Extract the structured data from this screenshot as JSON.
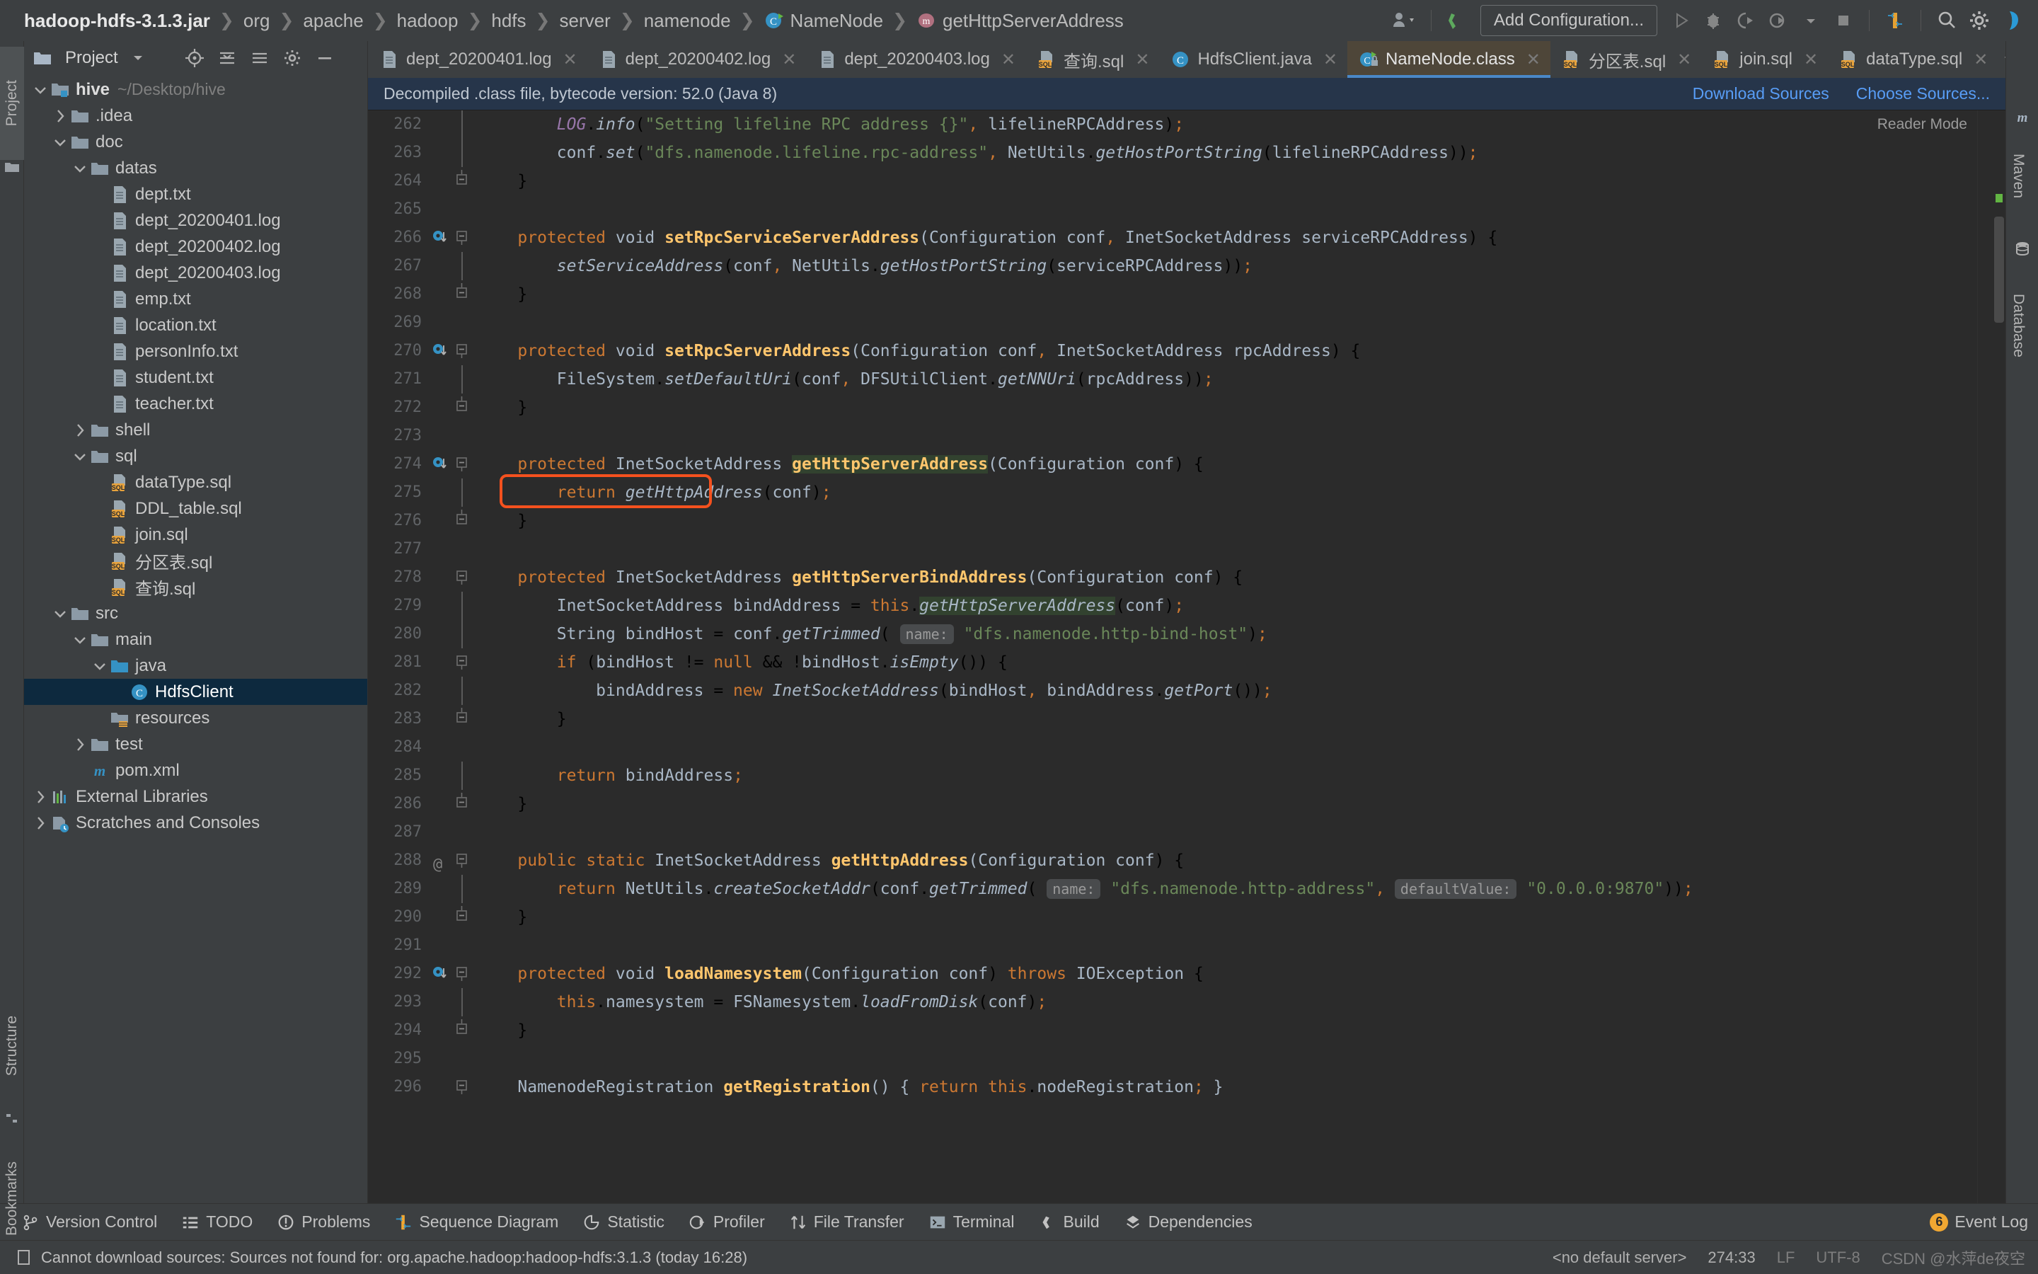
{
  "window": {
    "breadcrumb": [
      {
        "label": "hadoop-hdfs-3.1.3.jar",
        "icon": "jar-icon",
        "bold": true
      },
      {
        "label": "org",
        "icon": "none"
      },
      {
        "label": "apache",
        "icon": "none"
      },
      {
        "label": "hadoop",
        "icon": "none"
      },
      {
        "label": "hdfs",
        "icon": "none"
      },
      {
        "label": "server",
        "icon": "none"
      },
      {
        "label": "namenode",
        "icon": "none"
      },
      {
        "label": "NameNode",
        "icon": "class-icon"
      },
      {
        "label": "getHttpServerAddress",
        "icon": "method-icon"
      }
    ],
    "toolbar": {
      "add_configuration": "Add Configuration...",
      "icons": [
        "user-dropdown-icon",
        "build-icon",
        "run-icon",
        "debug-icon",
        "run-coverage-icon",
        "profile-icon",
        "stop-icon",
        "sequence-diagram-icon",
        "search-everywhere-icon",
        "settings-gear-icon",
        "ide-help-icon"
      ]
    }
  },
  "left_strip": {
    "top_tabs": [
      {
        "label": "Project",
        "icon": "project-folder-icon"
      }
    ],
    "bottom_tabs": [
      {
        "label": "Structure",
        "icon": "structure-icon"
      },
      {
        "label": "Bookmarks",
        "icon": "bookmark-icon"
      }
    ]
  },
  "right_strip": {
    "tabs": [
      {
        "label": "Maven",
        "icon": "maven-m-icon"
      },
      {
        "label": "Database",
        "icon": "database-icon"
      }
    ]
  },
  "project_panel": {
    "title": "Project",
    "header_icons": [
      "target-icon",
      "expand-icon",
      "collapse-icon",
      "settings-icon",
      "hide-icon"
    ],
    "tree": [
      {
        "label": "hive",
        "path": "~/Desktop/hive",
        "indent": 0,
        "twist": "down",
        "icon": "module-folder-icon",
        "bold": true
      },
      {
        "label": ".idea",
        "indent": 1,
        "twist": "right",
        "icon": "folder-icon"
      },
      {
        "label": "doc",
        "indent": 1,
        "twist": "down",
        "icon": "folder-icon"
      },
      {
        "label": "datas",
        "indent": 2,
        "twist": "down",
        "icon": "folder-icon"
      },
      {
        "label": "dept.txt",
        "indent": 3,
        "twist": "none",
        "icon": "text-file-icon"
      },
      {
        "label": "dept_20200401.log",
        "indent": 3,
        "twist": "none",
        "icon": "text-file-icon"
      },
      {
        "label": "dept_20200402.log",
        "indent": 3,
        "twist": "none",
        "icon": "text-file-icon"
      },
      {
        "label": "dept_20200403.log",
        "indent": 3,
        "twist": "none",
        "icon": "text-file-icon"
      },
      {
        "label": "emp.txt",
        "indent": 3,
        "twist": "none",
        "icon": "text-file-icon"
      },
      {
        "label": "location.txt",
        "indent": 3,
        "twist": "none",
        "icon": "text-file-icon"
      },
      {
        "label": "personInfo.txt",
        "indent": 3,
        "twist": "none",
        "icon": "text-file-icon"
      },
      {
        "label": "student.txt",
        "indent": 3,
        "twist": "none",
        "icon": "text-file-icon"
      },
      {
        "label": "teacher.txt",
        "indent": 3,
        "twist": "none",
        "icon": "text-file-icon"
      },
      {
        "label": "shell",
        "indent": 2,
        "twist": "right",
        "icon": "folder-icon"
      },
      {
        "label": "sql",
        "indent": 2,
        "twist": "down",
        "icon": "folder-icon"
      },
      {
        "label": "dataType.sql",
        "indent": 3,
        "twist": "none",
        "icon": "sql-file-icon"
      },
      {
        "label": "DDL_table.sql",
        "indent": 3,
        "twist": "none",
        "icon": "sql-file-icon"
      },
      {
        "label": "join.sql",
        "indent": 3,
        "twist": "none",
        "icon": "sql-file-icon"
      },
      {
        "label": "分区表.sql",
        "indent": 3,
        "twist": "none",
        "icon": "sql-file-icon"
      },
      {
        "label": "查询.sql",
        "indent": 3,
        "twist": "none",
        "icon": "sql-file-icon"
      },
      {
        "label": "src",
        "indent": 1,
        "twist": "down",
        "icon": "folder-icon"
      },
      {
        "label": "main",
        "indent": 2,
        "twist": "down",
        "icon": "folder-icon"
      },
      {
        "label": "java",
        "indent": 3,
        "twist": "down",
        "icon": "source-folder-icon"
      },
      {
        "label": "HdfsClient",
        "indent": 4,
        "twist": "none",
        "icon": "java-class-icon",
        "selected": true
      },
      {
        "label": "resources",
        "indent": 3,
        "twist": "none",
        "icon": "resources-folder-icon"
      },
      {
        "label": "test",
        "indent": 2,
        "twist": "right",
        "icon": "folder-icon"
      },
      {
        "label": "pom.xml",
        "indent": 2,
        "twist": "none",
        "icon": "maven-m-icon"
      },
      {
        "label": "External Libraries",
        "indent": 0,
        "twist": "right",
        "icon": "libraries-icon"
      },
      {
        "label": "Scratches and Consoles",
        "indent": 0,
        "twist": "right",
        "icon": "scratches-icon"
      }
    ]
  },
  "editor_tabs": [
    {
      "label": "dept_20200401.log",
      "icon": "text-file-icon",
      "active": false,
      "closable": true
    },
    {
      "label": "dept_20200402.log",
      "icon": "text-file-icon",
      "active": false,
      "closable": true
    },
    {
      "label": "dept_20200403.log",
      "icon": "text-file-icon",
      "active": false,
      "closable": true
    },
    {
      "label": "查询.sql",
      "icon": "sql-file-icon",
      "active": false,
      "closable": true
    },
    {
      "label": "HdfsClient.java",
      "icon": "java-class-icon",
      "active": false,
      "closable": true
    },
    {
      "label": "NameNode.class",
      "icon": "class-locked-icon",
      "active": true,
      "closable": true
    },
    {
      "label": "分区表.sql",
      "icon": "sql-file-icon",
      "active": false,
      "closable": true
    },
    {
      "label": "join.sql",
      "icon": "sql-file-icon",
      "active": false,
      "closable": true
    },
    {
      "label": "dataType.sql",
      "icon": "sql-file-icon",
      "active": false,
      "closable": true
    }
  ],
  "notification": {
    "text": "Decompiled .class file, bytecode version: 52.0 (Java 8)",
    "links": [
      "Download Sources",
      "Choose Sources..."
    ]
  },
  "reader_mode_label": "Reader Mode",
  "code": {
    "first_line": 262,
    "lines": [
      {
        "n": 262,
        "gutter": "",
        "fold": "bar"
      },
      {
        "n": 263,
        "gutter": "",
        "fold": "bar"
      },
      {
        "n": 264,
        "gutter": "",
        "fold": "end"
      },
      {
        "n": 265,
        "gutter": "",
        "fold": ""
      },
      {
        "n": 266,
        "gutter": "override",
        "fold": "start"
      },
      {
        "n": 267,
        "gutter": "",
        "fold": "bar"
      },
      {
        "n": 268,
        "gutter": "",
        "fold": "end"
      },
      {
        "n": 269,
        "gutter": "",
        "fold": ""
      },
      {
        "n": 270,
        "gutter": "override",
        "fold": "start"
      },
      {
        "n": 271,
        "gutter": "",
        "fold": "bar"
      },
      {
        "n": 272,
        "gutter": "",
        "fold": "end"
      },
      {
        "n": 273,
        "gutter": "",
        "fold": ""
      },
      {
        "n": 274,
        "gutter": "override",
        "fold": "start"
      },
      {
        "n": 275,
        "gutter": "",
        "fold": "bar"
      },
      {
        "n": 276,
        "gutter": "",
        "fold": "end"
      },
      {
        "n": 277,
        "gutter": "",
        "fold": ""
      },
      {
        "n": 278,
        "gutter": "",
        "fold": "start"
      },
      {
        "n": 279,
        "gutter": "",
        "fold": "bar"
      },
      {
        "n": 280,
        "gutter": "",
        "fold": "bar"
      },
      {
        "n": 281,
        "gutter": "",
        "fold": "start"
      },
      {
        "n": 282,
        "gutter": "",
        "fold": "bar"
      },
      {
        "n": 283,
        "gutter": "",
        "fold": "end"
      },
      {
        "n": 284,
        "gutter": "",
        "fold": ""
      },
      {
        "n": 285,
        "gutter": "",
        "fold": "bar"
      },
      {
        "n": 286,
        "gutter": "",
        "fold": "end"
      },
      {
        "n": 287,
        "gutter": "",
        "fold": ""
      },
      {
        "n": 288,
        "gutter": "annotation",
        "fold": "start"
      },
      {
        "n": 289,
        "gutter": "",
        "fold": "bar"
      },
      {
        "n": 290,
        "gutter": "",
        "fold": "end"
      },
      {
        "n": 291,
        "gutter": "",
        "fold": ""
      },
      {
        "n": 292,
        "gutter": "override",
        "fold": "start"
      },
      {
        "n": 293,
        "gutter": "",
        "fold": "bar"
      },
      {
        "n": 294,
        "gutter": "",
        "fold": "end"
      },
      {
        "n": 295,
        "gutter": "",
        "fold": ""
      },
      {
        "n": 296,
        "gutter": "",
        "fold": "start"
      }
    ],
    "text": [
      "        LOG.info(\"Setting lifeline RPC address {}\", lifelineRPCAddress);",
      "        conf.set(\"dfs.namenode.lifeline.rpc-address\", NetUtils.getHostPortString(lifelineRPCAddress));",
      "    }",
      "",
      "    protected void setRpcServiceServerAddress(Configuration conf, InetSocketAddress serviceRPCAddress) {",
      "        setServiceAddress(conf, NetUtils.getHostPortString(serviceRPCAddress));",
      "    }",
      "",
      "    protected void setRpcServerAddress(Configuration conf, InetSocketAddress rpcAddress) {",
      "        FileSystem.setDefaultUri(conf, DFSUtilClient.getNNUri(rpcAddress));",
      "    }",
      "",
      "    protected InetSocketAddress getHttpServerAddress(Configuration conf) {",
      "        return getHttpAddress(conf);",
      "    }",
      "",
      "    protected InetSocketAddress getHttpServerBindAddress(Configuration conf) {",
      "        InetSocketAddress bindAddress = this.getHttpServerAddress(conf);",
      "        String bindHost = conf.getTrimmed( name: \"dfs.namenode.http-bind-host\");",
      "        if (bindHost != null && !bindHost.isEmpty()) {",
      "            bindAddress = new InetSocketAddress(bindHost, bindAddress.getPort());",
      "        }",
      "",
      "        return bindAddress;",
      "    }",
      "",
      "    public static InetSocketAddress getHttpAddress(Configuration conf) {",
      "        return NetUtils.createSocketAddr(conf.getTrimmed( name: \"dfs.namenode.http-address\", defaultValue: \"0.0.0.0:9870\"));",
      "    }",
      "",
      "    protected void loadNamesystem(Configuration conf) throws IOException {",
      "        this.namesystem = FSNamesystem.loadFromDisk(conf);",
      "    }",
      "",
      "    NamenodeRegistration getRegistration() { return this.nodeRegistration; }"
    ],
    "annotation": {
      "type": "highlight-rectangle",
      "color": "#f4511e",
      "target_line": 275,
      "target_text": "return getHttpAddress(conf);"
    }
  },
  "bottom_tools": [
    {
      "label": "Version Control",
      "icon": "version-control-icon"
    },
    {
      "label": "TODO",
      "icon": "todo-icon"
    },
    {
      "label": "Problems",
      "icon": "problems-icon"
    },
    {
      "label": "Sequence Diagram",
      "icon": "sequence-diagram-icon"
    },
    {
      "label": "Statistic",
      "icon": "statistic-icon"
    },
    {
      "label": "Profiler",
      "icon": "profiler-icon"
    },
    {
      "label": "File Transfer",
      "icon": "file-transfer-icon"
    },
    {
      "label": "Terminal",
      "icon": "terminal-icon"
    },
    {
      "label": "Build",
      "icon": "build-icon"
    },
    {
      "label": "Dependencies",
      "icon": "dependencies-icon"
    }
  ],
  "event_log": {
    "label": "Event Log",
    "count": "6"
  },
  "status_bar": {
    "message": "Cannot download sources: Sources not found for: org.apache.hadoop:hadoop-hdfs:3.1.3 (today 16:28)",
    "server": "<no default server>",
    "caret": "274:33",
    "line_sep": "LF",
    "encoding": "UTF-8",
    "watermark": "CSDN @水萍de夜空"
  }
}
